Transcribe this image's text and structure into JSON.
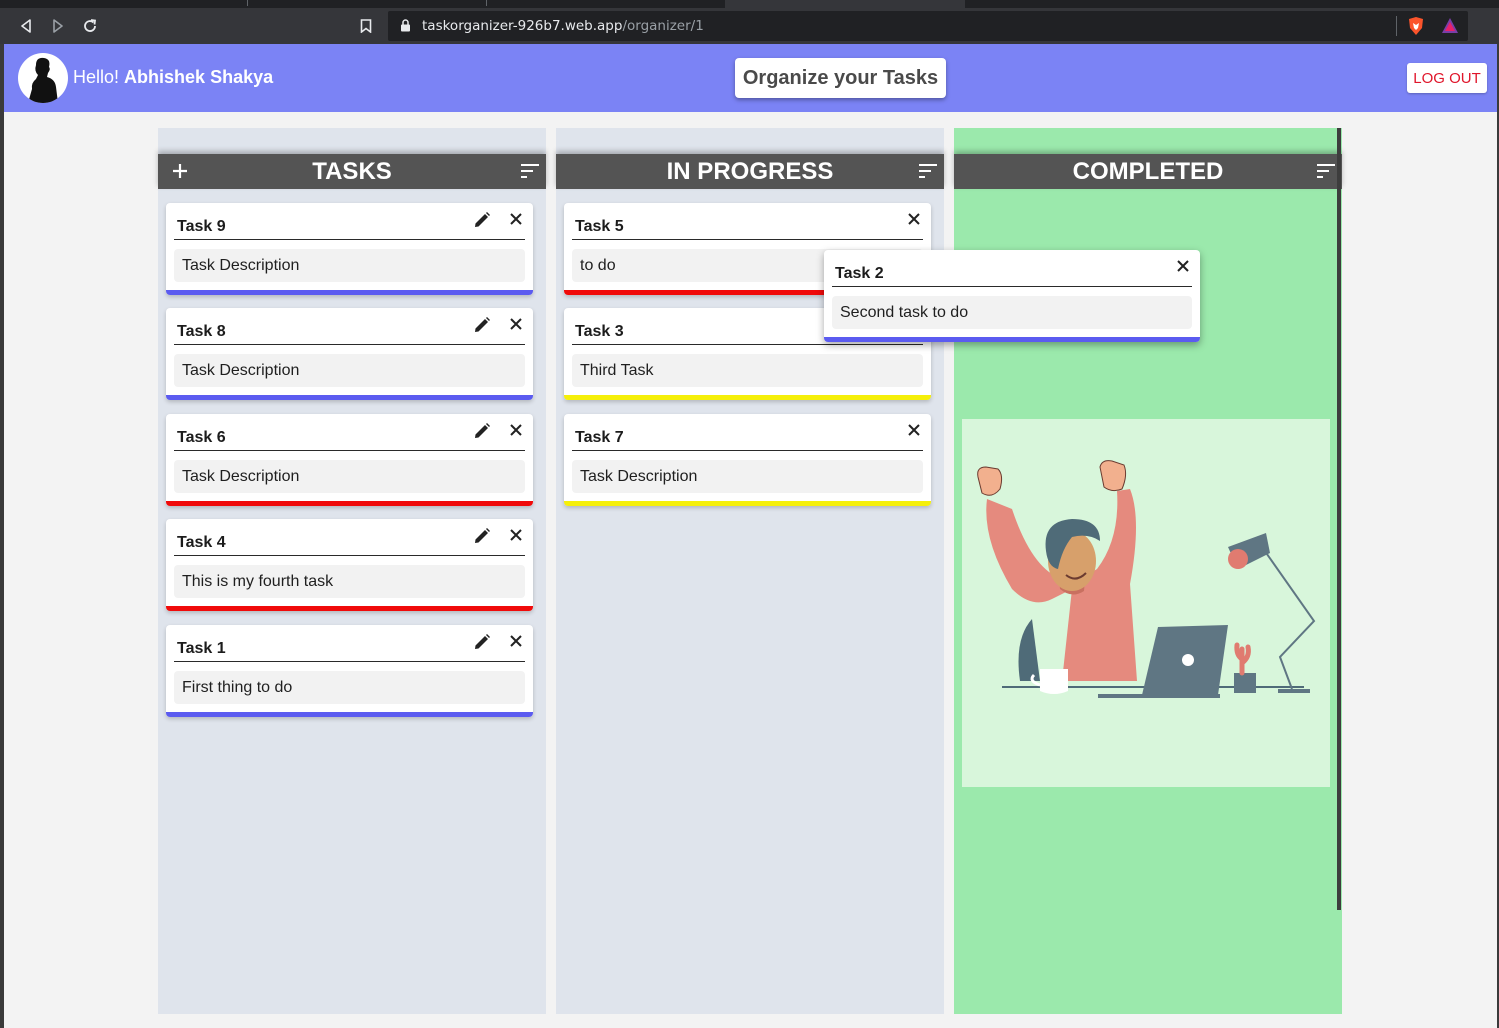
{
  "browser": {
    "url_host": "taskorganizer-926b7.web.app",
    "url_path": "/organizer/1"
  },
  "header": {
    "greeting": "Hello!",
    "user_name": "Abhishek Shakya",
    "title": "Organize your Tasks",
    "logout_label": "LOG OUT"
  },
  "colors": {
    "header_bg": "#7b83f5",
    "column_bg": "#dfe4ec",
    "completed_bg": "#9be9ac",
    "column_head_bg": "#545454",
    "priority_low": "#5b5bf0",
    "priority_high": "#f00a0a",
    "priority_medium": "#f5ef0a"
  },
  "columns": [
    {
      "title": "TASKS",
      "cards": [
        {
          "title": "Task 9",
          "description": "Task Description",
          "priority_color": "#5b5bf0"
        },
        {
          "title": "Task 8",
          "description": "Task Description",
          "priority_color": "#5b5bf0"
        },
        {
          "title": "Task 6",
          "description": "Task Description",
          "priority_color": "#f00a0a"
        },
        {
          "title": "Task 4",
          "description": "This is my fourth task",
          "priority_color": "#f00a0a"
        },
        {
          "title": "Task 1",
          "description": "First thing to do",
          "priority_color": "#5b5bf0"
        }
      ]
    },
    {
      "title": "IN PROGRESS",
      "cards": [
        {
          "title": "Task 5",
          "description": "to do",
          "priority_color": "#f00a0a"
        },
        {
          "title": "Task 3",
          "description": "Third Task",
          "priority_color": "#f5ef0a"
        },
        {
          "title": "Task 7",
          "description": "Task Description",
          "priority_color": "#f5ef0a"
        }
      ]
    },
    {
      "title": "COMPLETED",
      "cards": []
    }
  ],
  "dragging_card": {
    "title": "Task 2",
    "description": "Second task to do",
    "priority_color": "#5b5bf0"
  }
}
